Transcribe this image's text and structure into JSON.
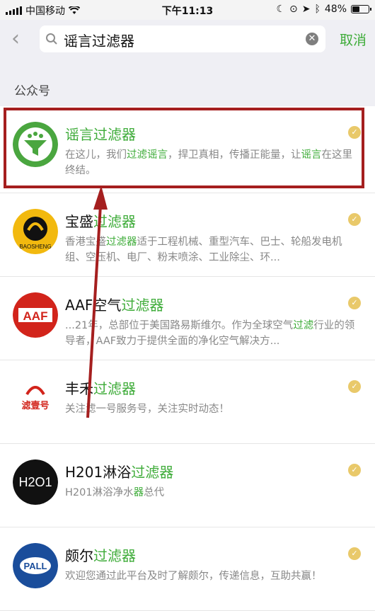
{
  "status_bar": {
    "carrier": "中国移动",
    "time": "下午11:13",
    "battery": "48%",
    "battery_level": 0.48
  },
  "search": {
    "back_label": "‹",
    "query": "谣言过滤器",
    "cancel_label": "取消"
  },
  "section_label": "公众号",
  "results": [
    {
      "name_prefix": "",
      "name_highlight": "谣言过滤器",
      "desc_html": "在这儿，我们<span class=\"hl\">过滤谣言</span>，捍卫真相，传播正能量，让<span class=\"hl\">谣言</span>在这里终结。",
      "avatar": "rumor-filter-logo"
    },
    {
      "name_prefix": "宝盛",
      "name_highlight": "过滤器",
      "desc_html": "香港宝盛<span class=\"hl\">过滤器</span>适于工程机械、重型汽车、巴士、轮船发电机组、空压机、电厂、粉末喷涂、工业除尘、环...",
      "avatar": "baosheng-logo"
    },
    {
      "name_prefix": "AAF空气",
      "name_highlight": "过滤器",
      "desc_html": "...21年，总部位于美国路易斯维尔。作为全球空气<span class=\"hl\">过滤</span>行业的领导者，AAF致力于提供全面的净化空气解决方...",
      "avatar": "aaf-logo"
    },
    {
      "name_prefix": "丰禾",
      "name_highlight": "过滤器",
      "desc_html": "关注滤一号服务号，关注实时动态！",
      "avatar": "lvyihao-logo"
    },
    {
      "name_prefix": "H201淋浴",
      "name_highlight": "过滤器",
      "desc_html": "H201淋浴净水<span class=\"hl\">器</span>总代",
      "avatar": "h201-logo"
    },
    {
      "name_prefix": "颇尔",
      "name_highlight": "过滤器",
      "desc_html": "欢迎您通过此平台及时了解颇尔，传递信息，互助共赢！",
      "avatar": "pall-logo"
    }
  ],
  "logo_text": {
    "aaf": "AAF",
    "h201": "H2O1",
    "pall": "PALL",
    "baosheng": "BAOSHENG",
    "lvyihao": "滤壹号"
  },
  "colors": {
    "accent": "#3fac3a",
    "annotation": "#a51f1f",
    "verified": "#e9c96a"
  }
}
